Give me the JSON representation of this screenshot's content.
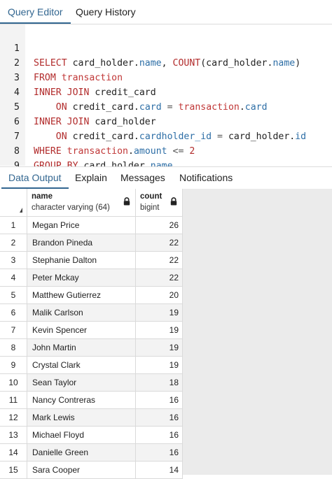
{
  "top_tabs": [
    "Query Editor",
    "Query History"
  ],
  "editor": {
    "line_numbers": [
      "1",
      "2",
      "3",
      "4",
      "5",
      "6",
      "7",
      "8",
      "9"
    ]
  },
  "bottom_tabs": [
    "Data Output",
    "Explain",
    "Messages",
    "Notifications"
  ],
  "grid": {
    "columns": [
      {
        "name": "name",
        "type": "character varying (64)"
      },
      {
        "name": "count",
        "type": "bigint"
      }
    ],
    "rows": [
      {
        "n": "1",
        "name": "Megan Price",
        "count": "26"
      },
      {
        "n": "2",
        "name": "Brandon Pineda",
        "count": "22"
      },
      {
        "n": "3",
        "name": "Stephanie Dalton",
        "count": "22"
      },
      {
        "n": "4",
        "name": "Peter Mckay",
        "count": "22"
      },
      {
        "n": "5",
        "name": "Matthew Gutierrez",
        "count": "20"
      },
      {
        "n": "6",
        "name": "Malik Carlson",
        "count": "19"
      },
      {
        "n": "7",
        "name": "Kevin Spencer",
        "count": "19"
      },
      {
        "n": "8",
        "name": "John Martin",
        "count": "19"
      },
      {
        "n": "9",
        "name": "Crystal Clark",
        "count": "19"
      },
      {
        "n": "10",
        "name": "Sean Taylor",
        "count": "18"
      },
      {
        "n": "11",
        "name": "Nancy Contreras",
        "count": "16"
      },
      {
        "n": "12",
        "name": "Mark Lewis",
        "count": "16"
      },
      {
        "n": "13",
        "name": "Michael Floyd",
        "count": "16"
      },
      {
        "n": "14",
        "name": "Danielle Green",
        "count": "16"
      },
      {
        "n": "15",
        "name": "Sara Cooper",
        "count": "14"
      }
    ]
  },
  "icons": {
    "lock": "lock-icon",
    "sort": "sort-indicator-icon"
  },
  "colors": {
    "accent": "#326690",
    "keyword": "#b22c2c",
    "property": "#2d6ea6"
  }
}
